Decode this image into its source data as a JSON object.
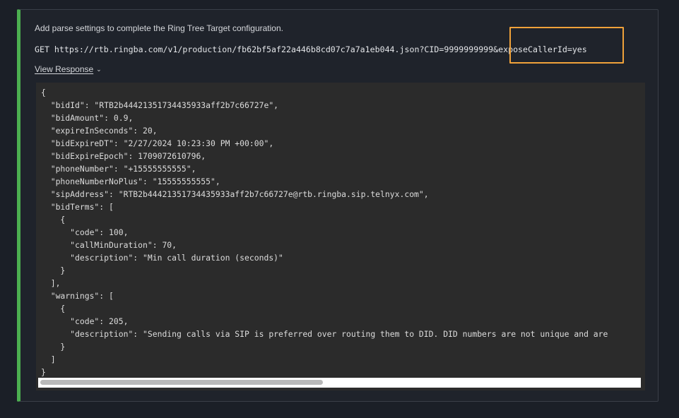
{
  "description": "Add parse settings to complete the Ring Tree Target configuration.",
  "request_url": "GET https://rtb.ringba.com/v1/production/fb62bf5af22a446b8cd07c7a7a1eb044.json?CID=9999999999&exposeCallerId=yes",
  "view_response_label": "View Response",
  "response_lines": [
    "{",
    "  \"bidId\": \"RTB2b44421351734435933aff2b7c66727e\",",
    "  \"bidAmount\": 0.9,",
    "  \"expireInSeconds\": 20,",
    "  \"bidExpireDT\": \"2/27/2024 10:23:30 PM +00:00\",",
    "  \"bidExpireEpoch\": 1709072610796,",
    "  \"phoneNumber\": \"+15555555555\",",
    "  \"phoneNumberNoPlus\": \"15555555555\",",
    "  \"sipAddress\": \"RTB2b44421351734435933aff2b7c66727e@rtb.ringba.sip.telnyx.com\",",
    "  \"bidTerms\": [",
    "    {",
    "      \"code\": 100,",
    "      \"callMinDuration\": 70,",
    "      \"description\": \"Min call duration (seconds)\"",
    "    }",
    "  ],",
    "  \"warnings\": [",
    "    {",
    "      \"code\": 205,",
    "      \"description\": \"Sending calls via SIP is preferred over routing them to DID. DID numbers are not unique and are",
    "    }",
    "  ]",
    "}"
  ],
  "colors": {
    "accent_border": "#4caf50",
    "highlight": "#f0a23a",
    "code_background": "#2b2b2b"
  }
}
